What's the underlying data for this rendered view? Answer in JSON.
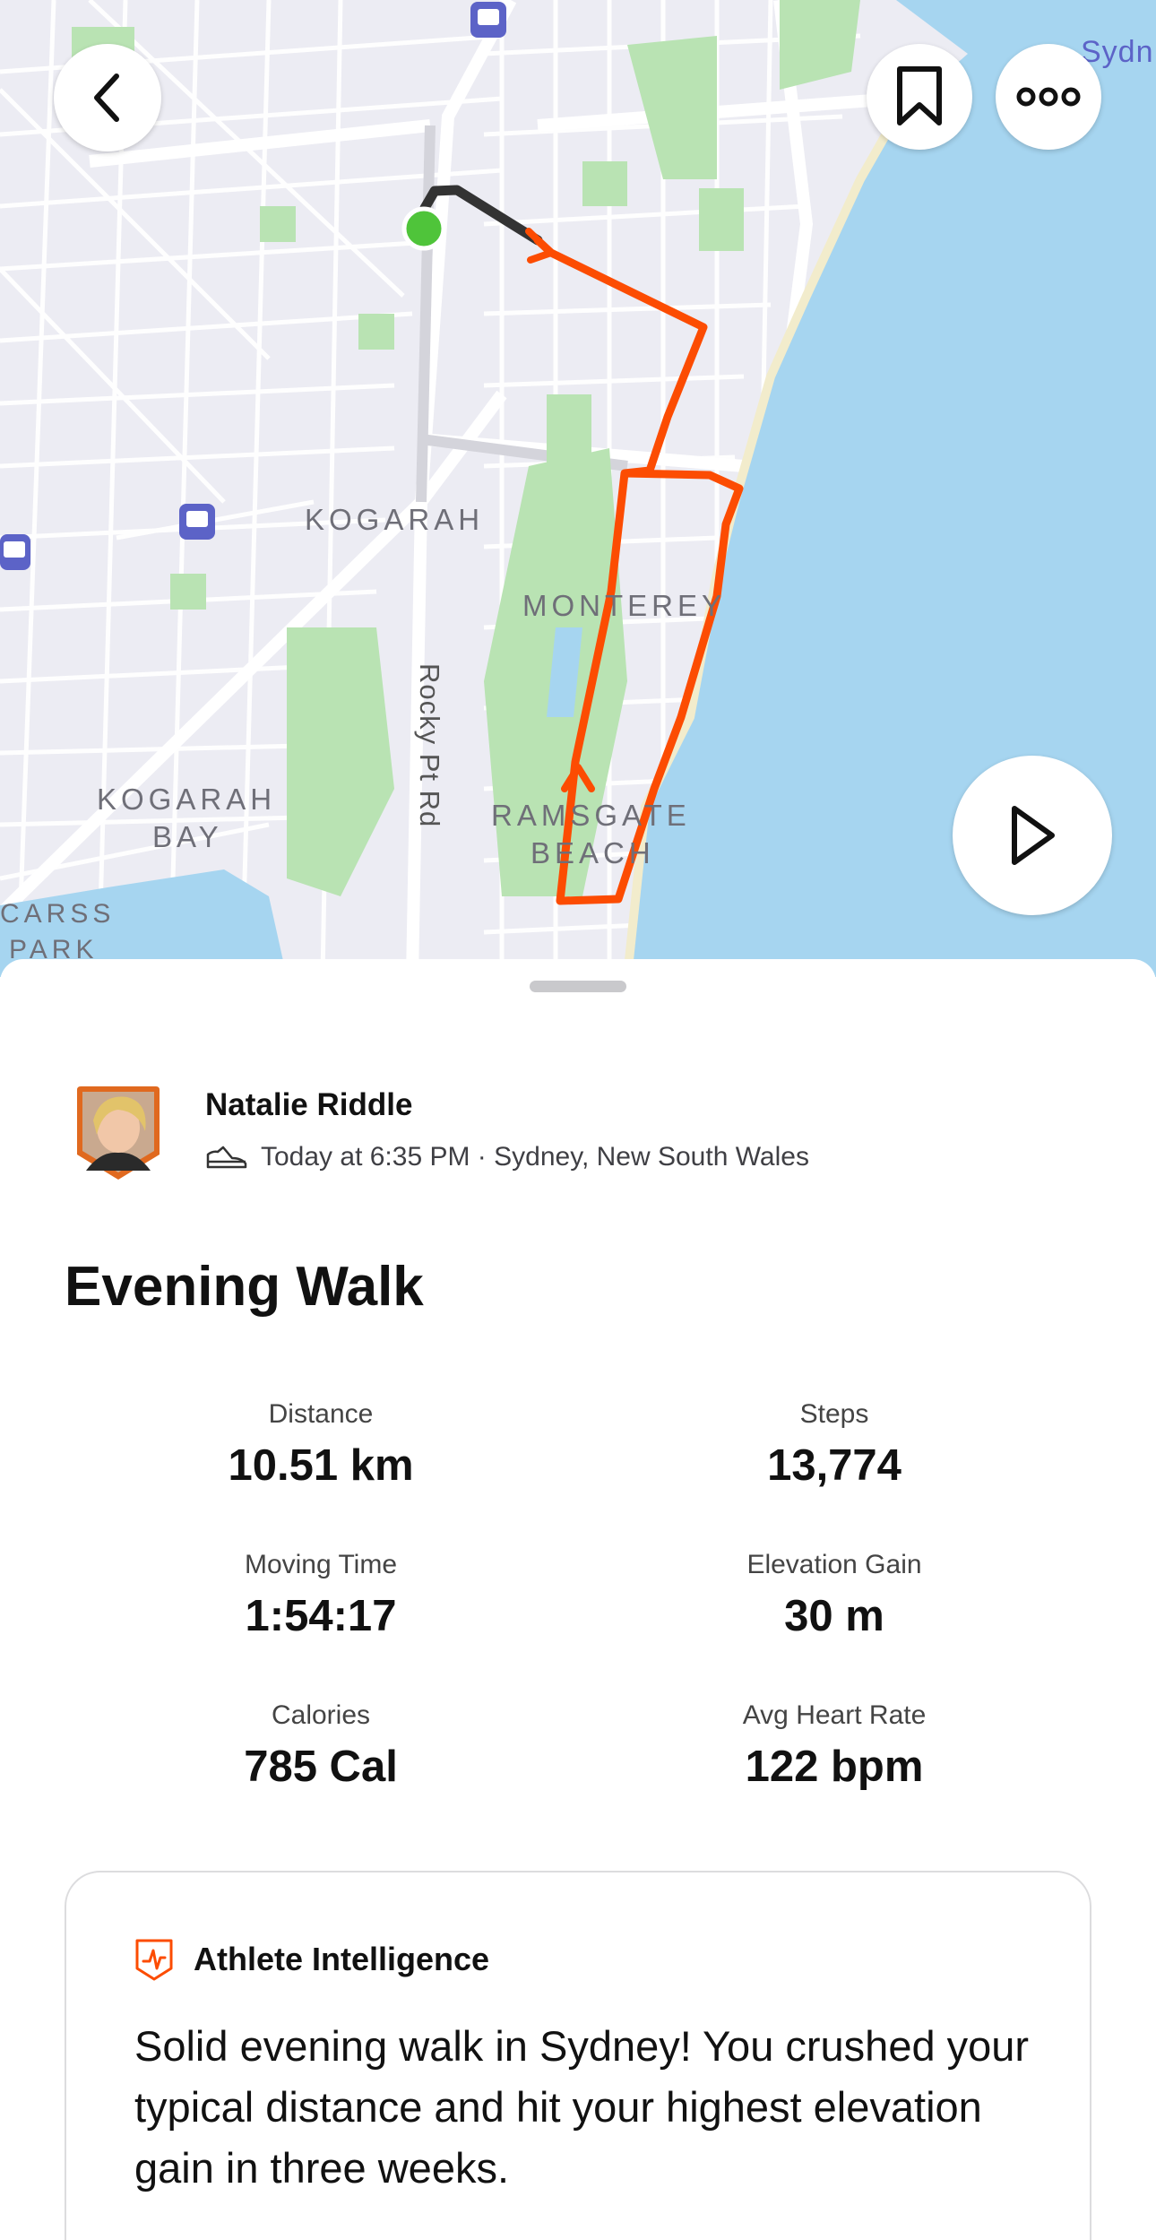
{
  "map": {
    "labels": {
      "kogarah": "KOGARAH",
      "monterey": "MONTEREY",
      "kogarah_bay_1": "KOGARAH",
      "kogarah_bay_2": "BAY",
      "ramsgate_1": "RAMSGATE",
      "ramsgate_2": "BEACH",
      "carss_1": "CARSS",
      "carss_2": "PARK",
      "sydney_partial": "Sydn",
      "road": "Rocky Pt Rd"
    },
    "colors": {
      "route": "#fc4c02",
      "water": "#a6d5f0",
      "park": "#b9e3b3",
      "start_marker": "#4fc43a"
    }
  },
  "buttons": {
    "back_icon": "chevron-left-icon",
    "bookmark_icon": "bookmark-icon",
    "more_icon": "more-icon",
    "play_icon": "play-icon"
  },
  "athlete": {
    "name": "Natalie Riddle",
    "meta": "Today at 6:35 PM · Sydney, New South Wales",
    "activity_icon": "shoe-icon"
  },
  "activity": {
    "title": "Evening Walk",
    "stats": [
      {
        "label": "Distance",
        "value": "10.51 km"
      },
      {
        "label": "Steps",
        "value": "13,774"
      },
      {
        "label": "Moving Time",
        "value": "1:54:17"
      },
      {
        "label": "Elevation Gain",
        "value": "30 m"
      },
      {
        "label": "Calories",
        "value": "785 Cal"
      },
      {
        "label": "Avg Heart Rate",
        "value": "122 bpm"
      }
    ]
  },
  "insight": {
    "title": "Athlete Intelligence",
    "icon": "athlete-intelligence-icon",
    "text": "Solid evening walk in Sydney! You crushed your typical distance and hit your highest elevation gain in three weeks."
  }
}
